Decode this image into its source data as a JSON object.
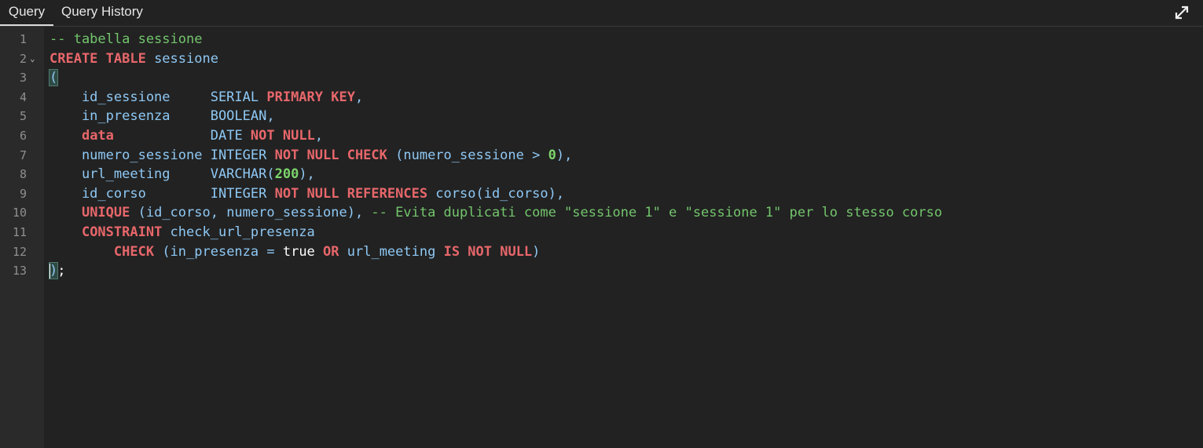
{
  "tabs": {
    "query_label": "Query",
    "history_label": "Query History"
  },
  "toolbar": {
    "expand_icon": "expand-icon"
  },
  "editor": {
    "language": "sql",
    "cursor_line": 13,
    "lines": [
      {
        "n": "1",
        "tokens": [
          {
            "t": "-- tabella sessione",
            "c": "com"
          }
        ]
      },
      {
        "n": "2",
        "fold": true,
        "tokens": [
          {
            "t": "CREATE TABLE ",
            "c": "kw"
          },
          {
            "t": "sessione",
            "c": "id"
          }
        ]
      },
      {
        "n": "3",
        "tokens": [
          {
            "t": "(",
            "c": "pun",
            "hl": true
          }
        ]
      },
      {
        "n": "4",
        "tokens": [
          {
            "t": "    id_sessione     ",
            "c": "id"
          },
          {
            "t": "SERIAL ",
            "c": "type"
          },
          {
            "t": "PRIMARY KEY",
            "c": "kw"
          },
          {
            "t": ",",
            "c": "pun"
          }
        ]
      },
      {
        "n": "5",
        "tokens": [
          {
            "t": "    in_presenza     ",
            "c": "id"
          },
          {
            "t": "BOOLEAN",
            "c": "type"
          },
          {
            "t": ",",
            "c": "pun"
          }
        ]
      },
      {
        "n": "6",
        "tokens": [
          {
            "t": "    ",
            "c": "id"
          },
          {
            "t": "data",
            "c": "kw"
          },
          {
            "t": "            ",
            "c": "id"
          },
          {
            "t": "DATE ",
            "c": "type"
          },
          {
            "t": "NOT NULL",
            "c": "kw"
          },
          {
            "t": ",",
            "c": "pun"
          }
        ]
      },
      {
        "n": "7",
        "tokens": [
          {
            "t": "    numero_sessione ",
            "c": "id"
          },
          {
            "t": "INTEGER ",
            "c": "type"
          },
          {
            "t": "NOT NULL CHECK ",
            "c": "kw"
          },
          {
            "t": "(numero_sessione > ",
            "c": "id"
          },
          {
            "t": "0",
            "c": "num"
          },
          {
            "t": "),",
            "c": "pun"
          }
        ]
      },
      {
        "n": "8",
        "tokens": [
          {
            "t": "    url_meeting     ",
            "c": "id"
          },
          {
            "t": "VARCHAR(",
            "c": "type"
          },
          {
            "t": "200",
            "c": "num"
          },
          {
            "t": "),",
            "c": "pun"
          }
        ]
      },
      {
        "n": "9",
        "tokens": [
          {
            "t": "    id_corso        ",
            "c": "id"
          },
          {
            "t": "INTEGER ",
            "c": "type"
          },
          {
            "t": "NOT NULL REFERENCES ",
            "c": "kw"
          },
          {
            "t": "corso(id_corso),",
            "c": "id"
          }
        ]
      },
      {
        "n": "10",
        "tokens": [
          {
            "t": "    ",
            "c": "id"
          },
          {
            "t": "UNIQUE ",
            "c": "kw"
          },
          {
            "t": "(id_corso, numero_sessione), ",
            "c": "id"
          },
          {
            "t": "-- Evita duplicati come \"sessione 1\" e \"sessione 1\" per lo stesso corso",
            "c": "com"
          }
        ]
      },
      {
        "n": "11",
        "tokens": [
          {
            "t": "    ",
            "c": "id"
          },
          {
            "t": "CONSTRAINT ",
            "c": "kw"
          },
          {
            "t": "check_url_presenza",
            "c": "id"
          }
        ]
      },
      {
        "n": "12",
        "tokens": [
          {
            "t": "        ",
            "c": "id"
          },
          {
            "t": "CHECK ",
            "c": "kw"
          },
          {
            "t": "(in_presenza = ",
            "c": "id"
          },
          {
            "t": "true ",
            "c": "plain"
          },
          {
            "t": "OR ",
            "c": "kw"
          },
          {
            "t": "url_meeting ",
            "c": "id"
          },
          {
            "t": "IS NOT NULL",
            "c": "kw"
          },
          {
            "t": ")",
            "c": "id"
          }
        ]
      },
      {
        "n": "13",
        "tokens": [
          {
            "t": ")",
            "c": "pun",
            "hl": true
          },
          {
            "t": ";",
            "c": "plain"
          }
        ]
      }
    ]
  }
}
